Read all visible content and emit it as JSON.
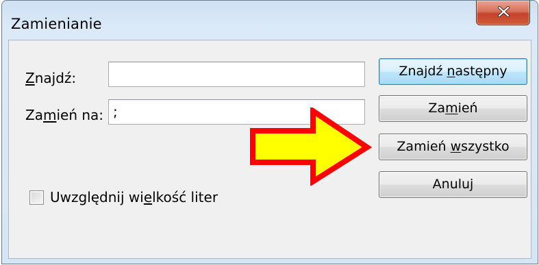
{
  "window": {
    "title": "Zamienianie",
    "close_icon": "close-x-icon"
  },
  "form": {
    "find_label": {
      "pre": "",
      "u": "Z",
      "post": "najdź:"
    },
    "find_value": "",
    "replace_label": {
      "pre": "Za",
      "u": "m",
      "post": "ień na:"
    },
    "replace_value": ";",
    "match_case": {
      "pre": "Uwzględnij wi",
      "u": "e",
      "post": "lkość liter"
    },
    "match_case_checked": false
  },
  "buttons": {
    "find_next": {
      "pre": "Znajdź ",
      "u": "n",
      "post": "astępny"
    },
    "replace": {
      "pre": "Za",
      "u": "m",
      "post": "ień"
    },
    "replace_all": {
      "pre": "Zamień ",
      "u": "w",
      "post": "szystko"
    },
    "cancel": {
      "pre": "Anuluj",
      "u": "",
      "post": ""
    }
  },
  "annotation": {
    "arrow_icon": "yellow-arrow-icon",
    "fill_color": "#ffff00",
    "outline_color": "#ff0000"
  }
}
